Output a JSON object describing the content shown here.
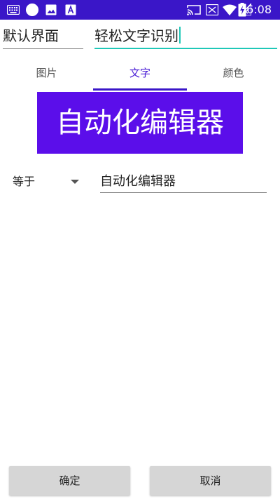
{
  "status_bar": {
    "time": "6:08",
    "background_color": "#3a16c8",
    "left_icons": [
      "keyboard-icon",
      "circle-icon",
      "image-icon",
      "text-a-icon"
    ],
    "right_icons": [
      "cast-icon",
      "no-signal-icon",
      "wifi-icon",
      "no-cellular-icon",
      "battery-charging-icon"
    ]
  },
  "form": {
    "name_value": "默认界面",
    "title_value": "轻松文字识别"
  },
  "tabs": [
    {
      "label": "图片",
      "active": false
    },
    {
      "label": "文字",
      "active": true
    },
    {
      "label": "颜色",
      "active": false
    }
  ],
  "accent_color": "#3a16c8",
  "focus_color": "#1fc8b8",
  "preview": {
    "text": "自动化编辑器",
    "background_color": "#5b0eea"
  },
  "condition": {
    "selected": "等于",
    "value": "自动化编辑器"
  },
  "buttons": {
    "confirm": "确定",
    "cancel": "取消"
  }
}
